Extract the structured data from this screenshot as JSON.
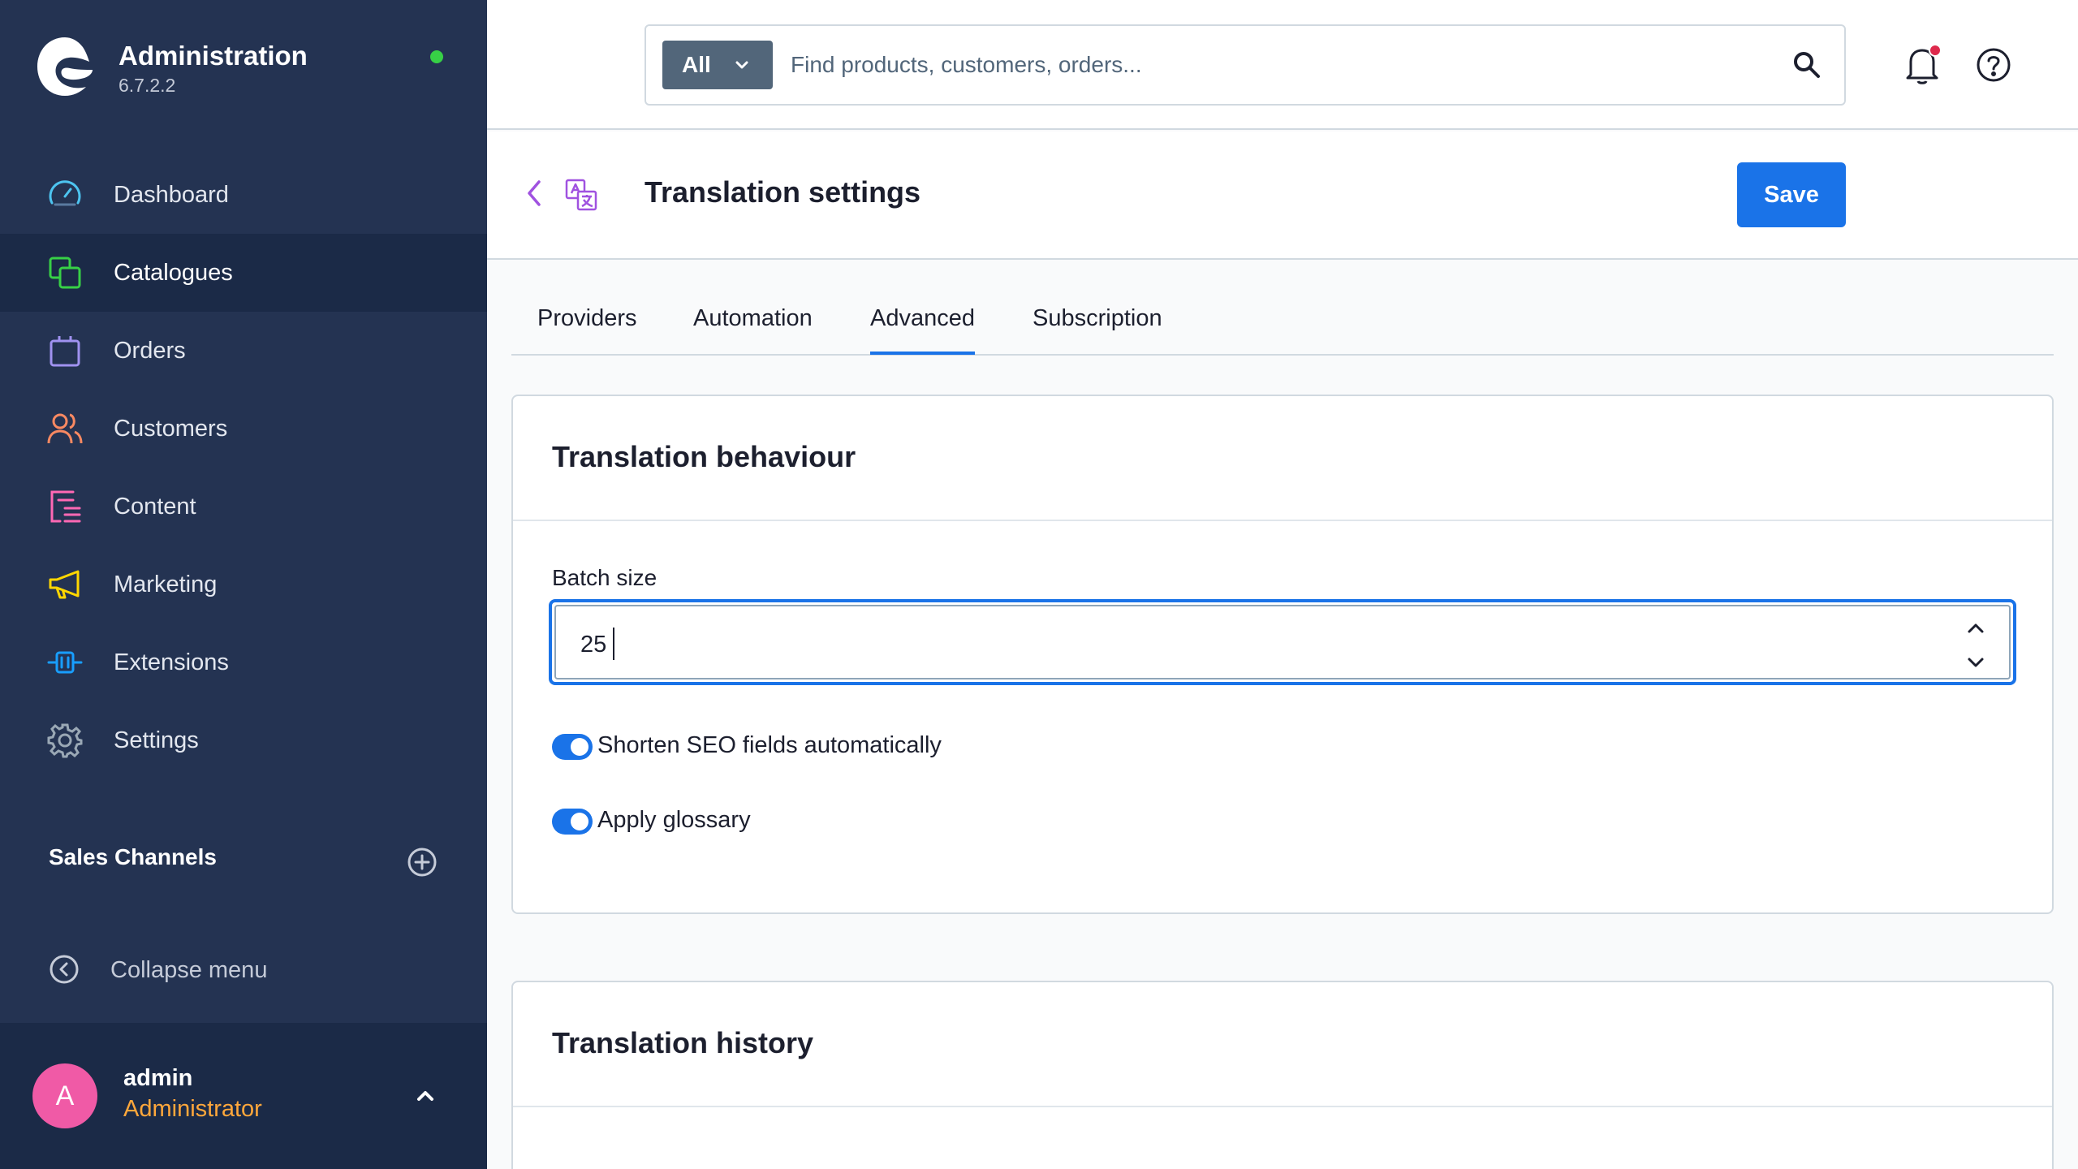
{
  "app": {
    "title": "Administration",
    "version": "6.7.2.2",
    "status_color": "#37d046"
  },
  "sidebar": {
    "items": [
      {
        "label": "Dashboard",
        "icon": "gauge-icon",
        "color": "#4dc4f0"
      },
      {
        "label": "Catalogues",
        "icon": "catalogue-icon",
        "color": "#37d046",
        "active": true
      },
      {
        "label": "Orders",
        "icon": "shopping-bag-icon",
        "color": "#a092f0"
      },
      {
        "label": "Customers",
        "icon": "users-icon",
        "color": "#f88962"
      },
      {
        "label": "Content",
        "icon": "content-list-icon",
        "color": "#ff68b4"
      },
      {
        "label": "Marketing",
        "icon": "megaphone-icon",
        "color": "#ffd700"
      },
      {
        "label": "Extensions",
        "icon": "plug-icon",
        "color": "#189eff"
      },
      {
        "label": "Settings",
        "icon": "gear-icon",
        "color": "#9aa8b5"
      }
    ],
    "sales_channels_label": "Sales Channels",
    "collapse_label": "Collapse menu"
  },
  "user": {
    "initial": "A",
    "name": "admin",
    "role": "Administrator"
  },
  "search": {
    "scope": "All",
    "placeholder": "Find products, customers, orders..."
  },
  "page": {
    "title": "Translation settings",
    "save_label": "Save"
  },
  "tabs": [
    {
      "label": "Providers"
    },
    {
      "label": "Automation"
    },
    {
      "label": "Advanced",
      "active": true
    },
    {
      "label": "Subscription"
    }
  ],
  "behaviour_card": {
    "title": "Translation behaviour",
    "batch_size_label": "Batch size",
    "batch_size_value": "25",
    "switches": [
      {
        "label": "Shorten SEO fields automatically",
        "on": true
      },
      {
        "label": "Apply glossary",
        "on": true
      }
    ]
  },
  "history_card": {
    "title": "Translation history"
  },
  "colors": {
    "sidebar_bg": "#243352",
    "primary": "#1a73e8",
    "notification_dot": "#de294c",
    "avatar": "#f05aa6",
    "role_text": "#ffa73b"
  }
}
